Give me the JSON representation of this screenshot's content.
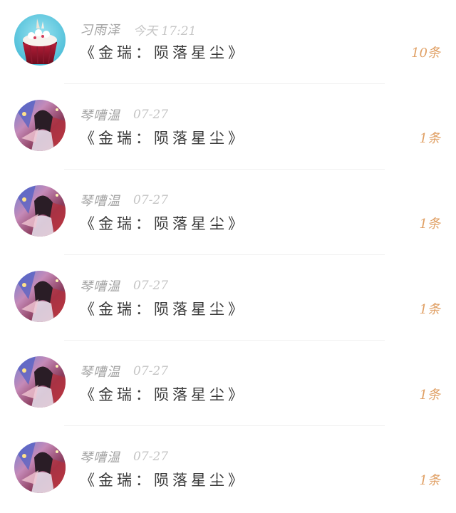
{
  "messages": [
    {
      "author": "习雨泽",
      "time": "今天 17:21",
      "title": "《金瑞：陨落星尘》",
      "count": "10条",
      "avatar": "cupcake-avatar"
    },
    {
      "author": "琴嘈温",
      "time": "07-27",
      "title": "《金瑞：陨落星尘》",
      "count": "1条",
      "avatar": "anime-girl-avatar"
    },
    {
      "author": "琴嘈温",
      "time": "07-27",
      "title": "《金瑞：陨落星尘》",
      "count": "1条",
      "avatar": "anime-girl-avatar"
    },
    {
      "author": "琴嘈温",
      "time": "07-27",
      "title": "《金瑞：陨落星尘》",
      "count": "1条",
      "avatar": "anime-girl-avatar"
    },
    {
      "author": "琴嘈温",
      "time": "07-27",
      "title": "《金瑞：陨落星尘》",
      "count": "1条",
      "avatar": "anime-girl-avatar"
    },
    {
      "author": "琴嘈温",
      "time": "07-27",
      "title": "《金瑞：陨落星尘》",
      "count": "1条",
      "avatar": "anime-girl-avatar"
    }
  ],
  "colors": {
    "author": "#a3a3a3",
    "time": "#c5c5c5",
    "title": "#3a3a3a",
    "count": "#e0a065",
    "divider": "#f0f0f0"
  }
}
